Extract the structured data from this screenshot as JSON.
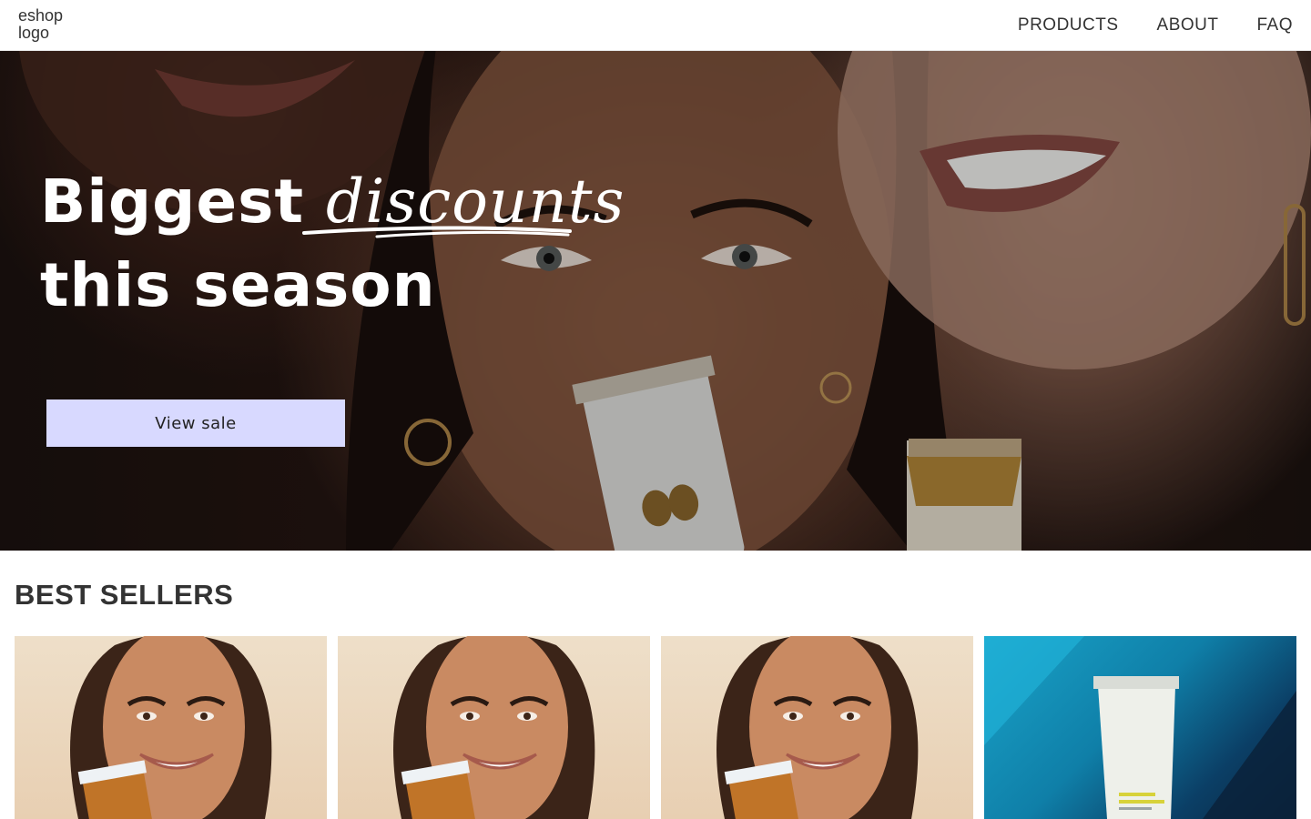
{
  "header": {
    "logo_text": "eshop\nlogo",
    "nav": [
      {
        "label": "PRODUCTS"
      },
      {
        "label": "ABOUT"
      },
      {
        "label": "FAQ"
      }
    ]
  },
  "hero": {
    "title_plain": "Biggest ",
    "title_accent": "discounts",
    "title_line2": "this season",
    "cta_label": "View sale"
  },
  "best_sellers": {
    "title": "BEST SELLERS",
    "products": [
      {
        "image": "model-with-orange-tube"
      },
      {
        "image": "model-with-orange-tube"
      },
      {
        "image": "model-with-orange-tube"
      },
      {
        "image": "white-tube-on-blue"
      }
    ]
  },
  "colors": {
    "cta_background": "#d8d9ff",
    "header_background": "#ffffff",
    "text_dark": "#333333"
  }
}
